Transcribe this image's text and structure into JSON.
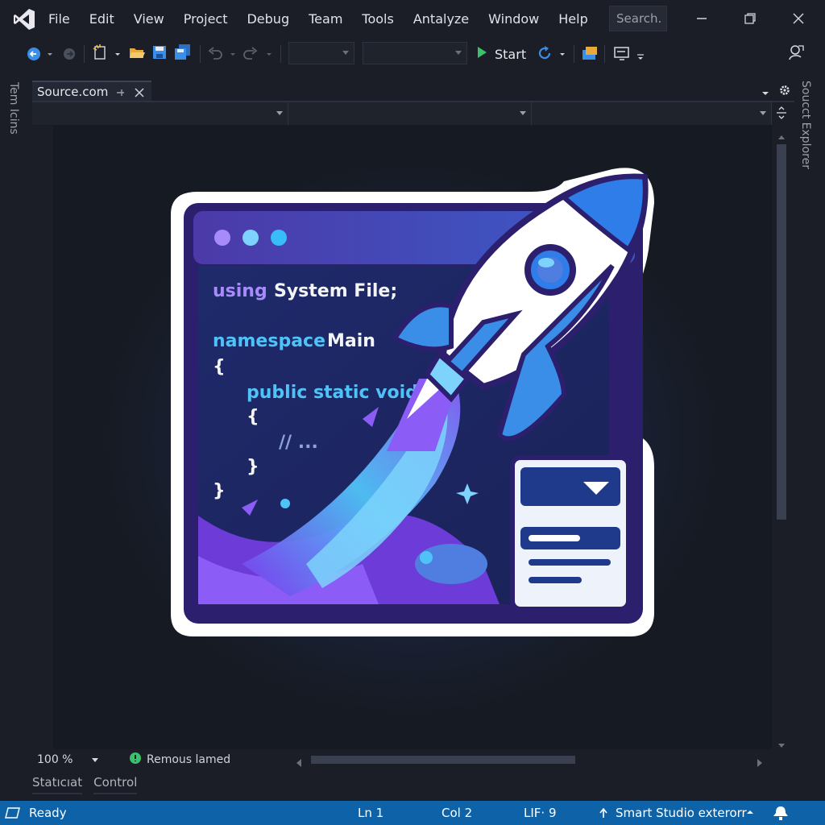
{
  "menu": {
    "items": [
      "File",
      "Edit",
      "View",
      "Project",
      "Debug",
      "Team",
      "Tools",
      "Antalyze",
      "Window",
      "Help"
    ],
    "search_placeholder": "Search."
  },
  "toolbar": {
    "start_label": "Start"
  },
  "panels": {
    "left_vertical_tab": "Tem Icins",
    "right_vertical_tab": "Soucct Explorer"
  },
  "document": {
    "tab_label": "Source.com"
  },
  "editor": {
    "illustration": {
      "code_lines": [
        {
          "keyword": "using",
          "rest": "System File;"
        },
        {
          "keyword": "namespace",
          "rest": "Main"
        },
        {
          "keyword": "",
          "rest": "{"
        },
        {
          "keyword": "public static void",
          "rest": ""
        },
        {
          "keyword": "",
          "rest": "{"
        },
        {
          "keyword": "",
          "rest": "// ..."
        },
        {
          "keyword": "",
          "rest": "}"
        },
        {
          "keyword": "",
          "rest": "}"
        }
      ]
    }
  },
  "editor_bottom": {
    "zoom": "100 %",
    "issues": "Remous lamed"
  },
  "tool_tabs": [
    "Statıcıat",
    "Control"
  ],
  "statusbar": {
    "ready": "Ready",
    "ln": "Ln 1",
    "col": "Col 2",
    "lf": "LIF· 9",
    "repo": "Smart Studio exterorr"
  },
  "colors": {
    "background": "#1b1e26",
    "statusbar": "#0e63a8",
    "keyword_purple": "#a78bfa",
    "keyword_blue": "#4fc3f7",
    "start_green": "#39c26b"
  },
  "icons": [
    "visual-studio-logo",
    "back-icon",
    "forward-icon",
    "new-project-icon",
    "open-folder-icon",
    "save-icon",
    "save-all-icon",
    "undo-icon",
    "redo-icon",
    "start-play-icon",
    "refresh-icon",
    "solution-icon",
    "layout-icon",
    "feedback-icon",
    "minimize-icon",
    "restore-icon",
    "close-icon",
    "pin-icon",
    "tab-close-icon",
    "gear-icon",
    "split-icon",
    "check-icon",
    "publish-icon",
    "notification-icon"
  ]
}
